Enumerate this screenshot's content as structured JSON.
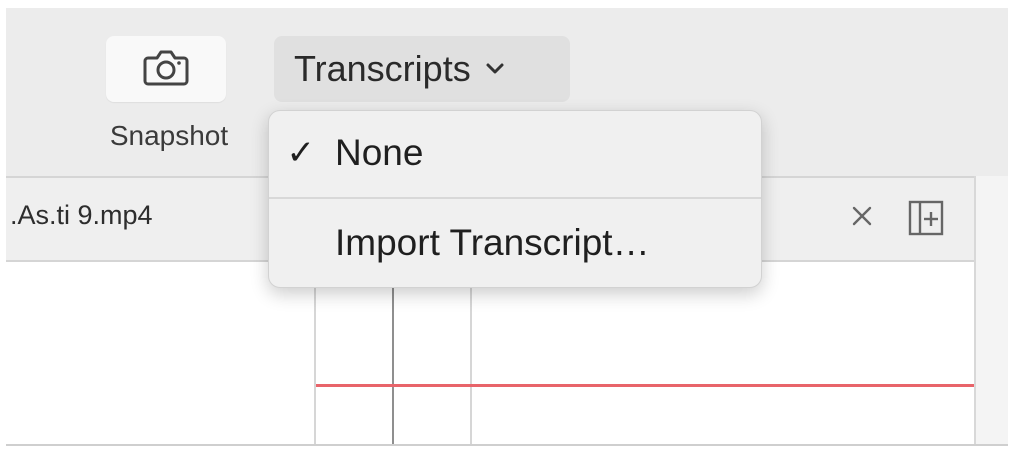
{
  "toolbar": {
    "snapshot_label": "Snapshot",
    "snapshot_icon": "camera-icon",
    "transcripts_label": "Transcripts",
    "transcripts_icon": "chevron-down-icon"
  },
  "tab": {
    "title": ".As.ti 9.mp4",
    "close_icon": "close-icon",
    "split_icon": "split-view-icon"
  },
  "menu": {
    "items": [
      {
        "label": "None",
        "checked": true,
        "check_glyph": "✓"
      },
      {
        "label": "Import Transcript…",
        "checked": false
      }
    ]
  },
  "colors": {
    "toolbar_bg": "#ececec",
    "menu_bg": "#f0f0f0",
    "playhead_line": "#e8646a"
  }
}
